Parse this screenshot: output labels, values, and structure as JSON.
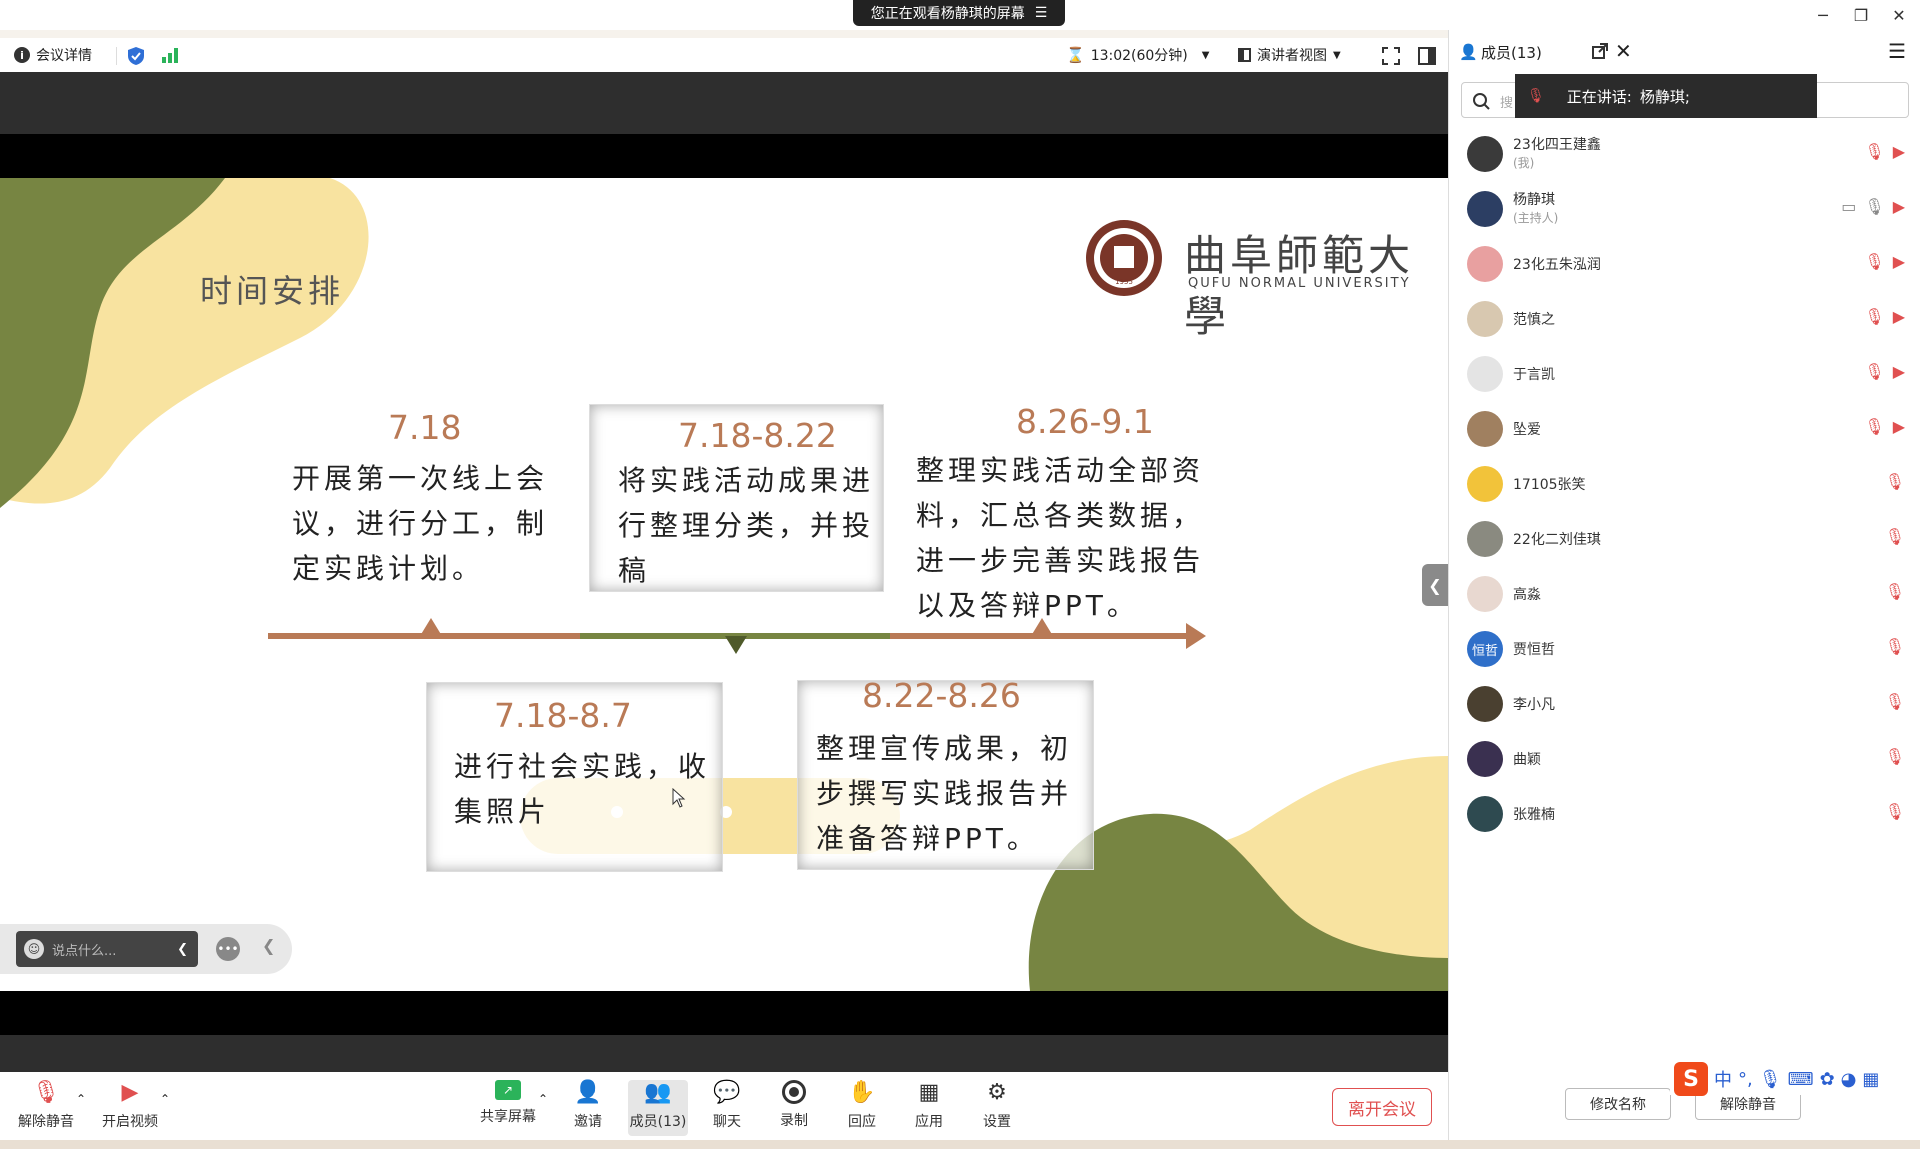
{
  "window": {
    "sharing_banner": "您正在观看杨静琪的屏幕",
    "minimize": "─",
    "restore": "❐",
    "close": "✕"
  },
  "toolbar": {
    "meeting_details": "会议详情",
    "timer": "13:02(60分钟)",
    "view_mode": "演讲者视图"
  },
  "panel_header": {
    "title": "成员(13)"
  },
  "slide": {
    "section_title": "时间安排",
    "university_cn": "曲阜師範大學",
    "university_en": "QUFU NORMAL UNIVERSITY",
    "seal_year": "1955",
    "items": [
      {
        "date": "7.18",
        "text": "开展第一次线上会议，进行分工，制定实践计划。"
      },
      {
        "date": "7.18-8.22",
        "text": "将实践活动成果进行整理分类，并投稿"
      },
      {
        "date": "8.26-9.1",
        "text": "整理实践活动全部资料，汇总各类数据，进一步完善实践报告以及答辩PPT。"
      },
      {
        "date": "7.18-8.7",
        "text": "进行社会实践，收集照片"
      },
      {
        "date": "8.22-8.26",
        "text": "整理宣传成果，初步撰写实践报告并准备答辩PPT。"
      }
    ]
  },
  "chat_bar": {
    "placeholder": "说点什么..."
  },
  "members_panel": {
    "search_placeholder": "搜",
    "speaking_label": "正在讲话:",
    "speaking_name": "杨静琪;",
    "members": [
      {
        "name": "23化四王建鑫",
        "role": "(我)",
        "avatar_color": "#3a3a3a",
        "avatar_text": ""
      },
      {
        "name": "杨静琪",
        "role": "(主持人)",
        "avatar_color": "#2c3e63",
        "avatar_text": ""
      },
      {
        "name": "23化五朱泓润",
        "role": "",
        "avatar_color": "#e8a0a0",
        "avatar_text": ""
      },
      {
        "name": "范慎之",
        "role": "",
        "avatar_color": "#d8c8b0",
        "avatar_text": ""
      },
      {
        "name": "于言凯",
        "role": "",
        "avatar_color": "#e4e4e4",
        "avatar_text": ""
      },
      {
        "name": "坠爱",
        "role": "",
        "avatar_color": "#a08060",
        "avatar_text": ""
      },
      {
        "name": "17105张笑",
        "role": "",
        "avatar_color": "#f2c33a",
        "avatar_text": ""
      },
      {
        "name": "22化二刘佳琪",
        "role": "",
        "avatar_color": "#8a8a80",
        "avatar_text": ""
      },
      {
        "name": "高淼",
        "role": "",
        "avatar_color": "#e8d8d0",
        "avatar_text": ""
      },
      {
        "name": "贾恒哲",
        "role": "",
        "avatar_color": "#2f6fc9",
        "avatar_text": "恒哲"
      },
      {
        "name": "李小凡",
        "role": "",
        "avatar_color": "#4a4030",
        "avatar_text": ""
      },
      {
        "name": "曲颖",
        "role": "",
        "avatar_color": "#3a3050",
        "avatar_text": ""
      },
      {
        "name": "张雅楠",
        "role": "",
        "avatar_color": "#2e4a50",
        "avatar_text": ""
      }
    ],
    "rename_button": "修改名称",
    "unmute_all_button": "解除静音"
  },
  "bottom_bar": {
    "unmute": "解除静音",
    "start_video": "开启视频",
    "share_screen": "共享屏幕",
    "invite": "邀请",
    "members": "成员(13)",
    "chat": "聊天",
    "record": "录制",
    "reactions": "回应",
    "apps": "应用",
    "settings": "设置",
    "leave": "离开会议"
  },
  "ime": {
    "lang": "中"
  },
  "colors": {
    "accent_orange": "#b97a56",
    "olive": "#778542",
    "pale_yellow": "#f8e3a0",
    "leave_red": "#e05050"
  }
}
